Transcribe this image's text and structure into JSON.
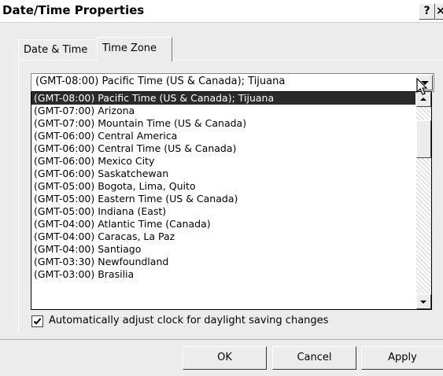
{
  "window": {
    "title": "Date/Time Properties",
    "help_label": "?",
    "close_label": "×"
  },
  "tabs": [
    {
      "label": "Date & Time",
      "active": false
    },
    {
      "label": "Time Zone",
      "active": true
    }
  ],
  "timezone": {
    "selected": "(GMT-08:00) Pacific Time (US & Canada); Tijuana",
    "options": [
      "(GMT-08:00) Pacific Time (US & Canada); Tijuana",
      "(GMT-07:00) Arizona",
      "(GMT-07:00) Mountain Time (US & Canada)",
      "(GMT-06:00) Central America",
      "(GMT-06:00) Central Time (US & Canada)",
      "(GMT-06:00) Mexico City",
      "(GMT-06:00) Saskatchewan",
      "(GMT-05:00) Bogota, Lima, Quito",
      "(GMT-05:00) Eastern Time (US & Canada)",
      "(GMT-05:00) Indiana (East)",
      "(GMT-04:00) Atlantic Time (Canada)",
      "(GMT-04:00) Caracas, La Paz",
      "(GMT-04:00) Santiago",
      "(GMT-03:30) Newfoundland",
      "(GMT-03:00) Brasilia"
    ]
  },
  "daylight": {
    "label": "Automatically adjust clock for daylight saving changes",
    "checked": true
  },
  "buttons": {
    "ok": "OK",
    "cancel": "Cancel",
    "apply": "Apply"
  }
}
